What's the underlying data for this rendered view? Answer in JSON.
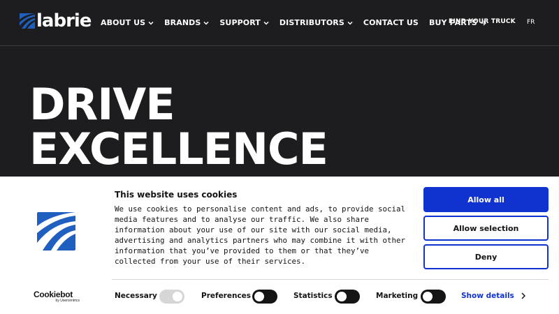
{
  "brand": {
    "name": "labrie",
    "accent": "#1f5fbf"
  },
  "nav": {
    "items": [
      {
        "label": "ABOUT US",
        "dropdown": true
      },
      {
        "label": "BRANDS",
        "dropdown": true
      },
      {
        "label": "SUPPORT",
        "dropdown": true
      },
      {
        "label": "DISTRIBUTORS",
        "dropdown": true
      },
      {
        "label": "CONTACT US",
        "dropdown": false
      },
      {
        "label": "BUY PARTS",
        "arrow": true
      }
    ],
    "find_truck": "FIND YOUR TRUCK",
    "language": "FR"
  },
  "hero": {
    "line1": "DRIVE",
    "line2": "EXCELLENCE"
  },
  "cookie": {
    "title": "This website uses cookies",
    "text": "We use cookies to personalise content and ads, to provide social media features and to analyse our traffic. We also share information about your use of our site with our social media, advertising and analytics partners who may combine it with other information that you’ve provided to them or that they’ve collected from your use of their services.",
    "buttons": {
      "allow_all": "Allow all",
      "allow_selection": "Allow selection",
      "deny": "Deny"
    },
    "toggles": {
      "necessary": "Necessary",
      "preferences": "Preferences",
      "statistics": "Statistics",
      "marketing": "Marketing"
    },
    "show_details": "Show details",
    "provider": {
      "name": "Cookiebot",
      "by": "by Usercentrics"
    },
    "accent": "#1032cf"
  }
}
